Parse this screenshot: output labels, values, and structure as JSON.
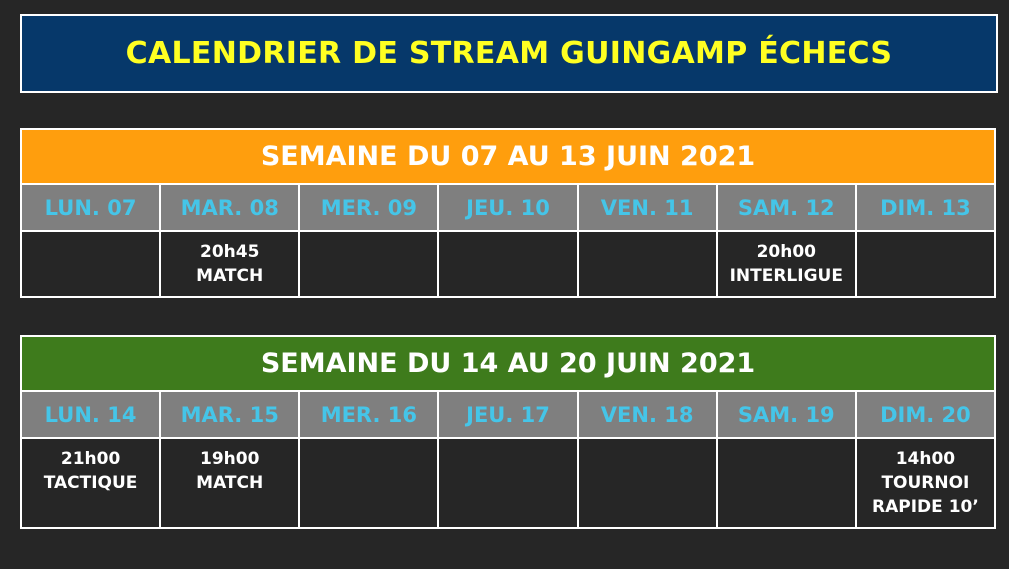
{
  "title": "CALENDRIER DE STREAM GUINGAMP ÉCHECS",
  "colors": {
    "title_bg": "#06386a",
    "title_text": "#ffff22",
    "week1_bg": "#ff9e0d",
    "week2_bg": "#3e7b1c",
    "day_header_bg": "#7f7f7f",
    "day_header_text": "#45c5e8",
    "page_bg": "#262626"
  },
  "weeks": [
    {
      "label": "SEMAINE DU 07 AU 13 JUIN 2021",
      "days": [
        {
          "name": "LUN. 07",
          "lines": []
        },
        {
          "name": "MAR. 08",
          "lines": [
            "20h45",
            "MATCH"
          ]
        },
        {
          "name": "MER. 09",
          "lines": []
        },
        {
          "name": "JEU. 10",
          "lines": []
        },
        {
          "name": "VEN. 11",
          "lines": []
        },
        {
          "name": "SAM. 12",
          "lines": [
            "20h00",
            "INTERLIGUE"
          ]
        },
        {
          "name": "DIM. 13",
          "lines": []
        }
      ]
    },
    {
      "label": "SEMAINE DU 14 AU 20 JUIN 2021",
      "days": [
        {
          "name": "LUN. 14",
          "lines": [
            "21h00",
            "TACTIQUE"
          ]
        },
        {
          "name": "MAR. 15",
          "lines": [
            "19h00",
            "MATCH"
          ]
        },
        {
          "name": "MER. 16",
          "lines": []
        },
        {
          "name": "JEU. 17",
          "lines": []
        },
        {
          "name": "VEN. 18",
          "lines": []
        },
        {
          "name": "SAM. 19",
          "lines": []
        },
        {
          "name": "DIM. 20",
          "lines": [
            "14h00",
            "TOURNOI",
            "RAPIDE 10’"
          ]
        }
      ]
    }
  ]
}
